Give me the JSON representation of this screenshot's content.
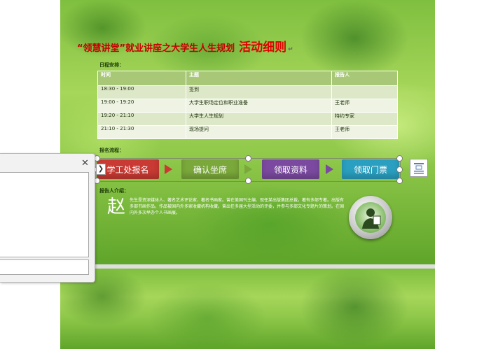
{
  "document": {
    "title": "“领慧讲堂”就业讲座之大学生人生规划",
    "title_emphasis": "活动细则",
    "schedule_label": "日程安排：",
    "process_label": "报名流程：",
    "speaker_label": "报告人介绍：",
    "schedule": {
      "headers": [
        "时间",
        "主题",
        "报告人"
      ],
      "rows": [
        {
          "time": "18:30 - 19:00",
          "topic": "签到",
          "speaker": ""
        },
        {
          "time": "19:00 - 19:20",
          "topic": "大学生职场定位和职业准备",
          "speaker": "王老师"
        },
        {
          "time": "19:20 - 21:10",
          "topic": "大学生人生规划",
          "speaker": "特约专家"
        },
        {
          "time": "21:10 - 21:30",
          "topic": "现场提问",
          "speaker": "王老师"
        }
      ]
    },
    "process_steps": [
      {
        "label": "学工处报名",
        "color": "#c83a33"
      },
      {
        "label": "确认坐席",
        "color": "#7aa83a"
      },
      {
        "label": "领取资料",
        "color": "#7b4aa0"
      },
      {
        "label": "领取门票",
        "color": "#2a9fc0"
      }
    ],
    "speaker_initial": "赵",
    "speaker_bio": "先生是资深媒体人、著名艺术评论家、著名书画家。曾在美国刊主编、现任某出版集团总裁，著有多部专著。出版有多部书画作品，作品被国内外多家收藏机构收藏。曾出任多届大型活动的评委，并参与多部文化专题片的策划。在国内外多次举办个人书画展。"
  },
  "panel": {
    "close_label": "✕"
  },
  "colors": {
    "title_red": "#c40000",
    "table_header": "#a8c878"
  }
}
